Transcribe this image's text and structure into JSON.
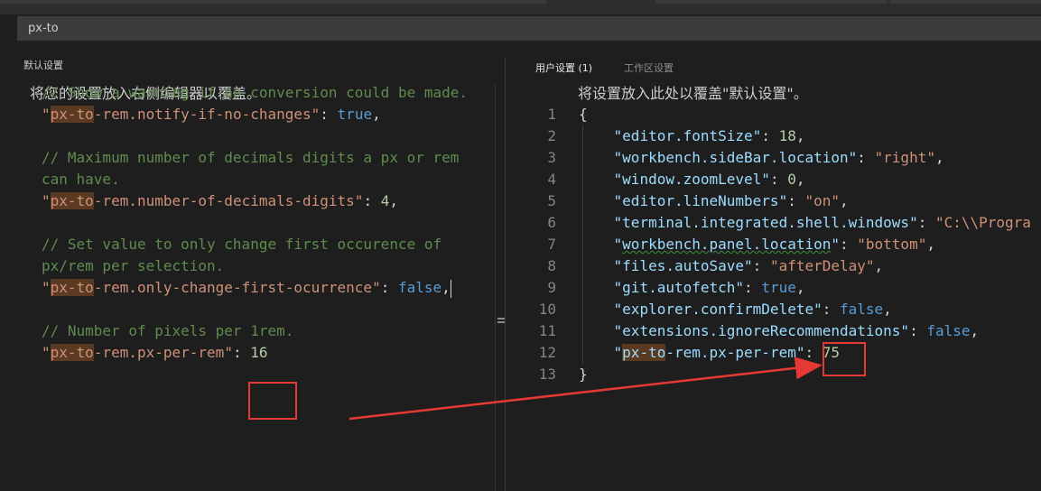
{
  "search": {
    "value": "px-to"
  },
  "left_pane": {
    "header": "默认设置",
    "info": "将您的设置放入右侧编辑器以覆盖。",
    "lines": [
      {
        "comment": "// Show a warning if no conversion could be made."
      },
      {
        "key_prefix": "px-to",
        "key_rest": "-rem.notify-if-no-changes",
        "value": "true",
        "value_type": "kw"
      },
      {
        "blank": true
      },
      {
        "comment": "// Maximum number of decimals digits a px or rem"
      },
      {
        "comment": "can have."
      },
      {
        "key_prefix": "px-to",
        "key_rest": "-rem.number-of-decimals-digits",
        "value": "4",
        "value_type": "num"
      },
      {
        "blank": true
      },
      {
        "comment": "// Set value to only change first occurence of"
      },
      {
        "comment": "px/rem per selection."
      },
      {
        "key_prefix": "px-to",
        "key_rest": "-rem.only-change-first-ocurrence",
        "value": "false",
        "value_type": "kw",
        "cursor": true
      },
      {
        "blank": true
      },
      {
        "comment": "// Number of pixels per 1rem."
      },
      {
        "key_prefix": "px-to",
        "key_rest": "-rem.px-per-rem",
        "value": "16",
        "value_type": "num",
        "last": true
      }
    ]
  },
  "right_pane": {
    "tabs": [
      {
        "label": "用户设置 (1)",
        "active": true
      },
      {
        "label": "工作区设置",
        "active": false
      }
    ],
    "info": "将设置放入此处以覆盖\"默认设置\"。",
    "line_numbers": [
      "1",
      "2",
      "3",
      "4",
      "5",
      "6",
      "7",
      "8",
      "9",
      "10",
      "11",
      "12",
      "13"
    ],
    "lines": [
      {
        "raw": "{"
      },
      {
        "key": "editor.fontSize",
        "value": "18",
        "value_type": "num"
      },
      {
        "key": "workbench.sideBar.location",
        "value": "\"right\"",
        "value_type": "str"
      },
      {
        "key": "window.zoomLevel",
        "value": "0",
        "value_type": "num"
      },
      {
        "key": "editor.lineNumbers",
        "value": "\"on\"",
        "value_type": "str"
      },
      {
        "key": "terminal.integrated.shell.windows",
        "value": "\"C:\\\\Progra",
        "value_type": "str",
        "no_comma": true
      },
      {
        "key": "workbench.panel.location",
        "value": "\"bottom\"",
        "value_type": "str",
        "squiggle": true
      },
      {
        "key": "files.autoSave",
        "value": "\"afterDelay\"",
        "value_type": "str"
      },
      {
        "key": "git.autofetch",
        "value": "true",
        "value_type": "kw"
      },
      {
        "key": "explorer.confirmDelete",
        "value": "false",
        "value_type": "kw"
      },
      {
        "key": "extensions.ignoreRecommendations",
        "value": "false",
        "value_type": "kw"
      },
      {
        "key_prefix": "px-to",
        "key_rest": "-rem.px-per-rem",
        "value": "75",
        "value_type": "num",
        "no_comma": true
      },
      {
        "raw": "}"
      }
    ]
  },
  "colors": {
    "comment": "#608b4e",
    "string": "#ce9178",
    "keyword": "#569cd6",
    "number": "#b5cea8",
    "annotation": "#e53935"
  }
}
